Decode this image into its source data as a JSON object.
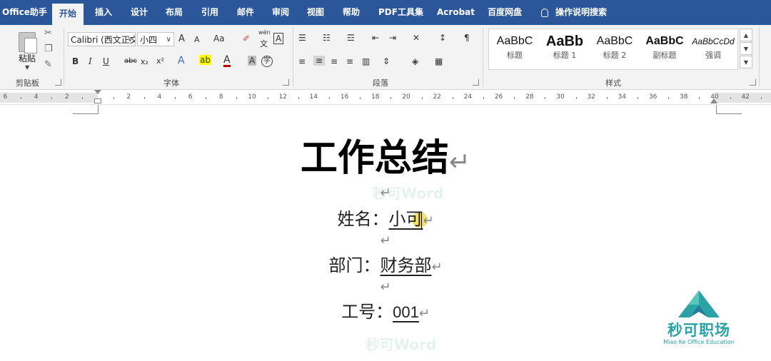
{
  "tabs": [
    {
      "label": "Office助手"
    },
    {
      "label": "开始"
    },
    {
      "label": "插入"
    },
    {
      "label": "设计"
    },
    {
      "label": "布局"
    },
    {
      "label": "引用"
    },
    {
      "label": "邮件"
    },
    {
      "label": "审阅"
    },
    {
      "label": "视图"
    },
    {
      "label": "帮助"
    },
    {
      "label": "PDF工具集"
    },
    {
      "label": "Acrobat"
    },
    {
      "label": "百度网盘"
    }
  ],
  "active_tab": "开始",
  "tell_me": "操作说明搜索",
  "ribbon": {
    "clipboard": {
      "paste_label": "粘贴",
      "group_label": "剪贴板"
    },
    "font": {
      "font_name": "Calibri (西文正文)",
      "font_size": "小四",
      "group_label": "字体",
      "grow": "A",
      "shrink": "A",
      "case": "Aa",
      "pinyin_top": "wén",
      "pinyin_bottom": "文",
      "border_char": "A",
      "bold": "B",
      "italic": "I",
      "underline": "U",
      "strike": "abc",
      "subscript": "x₂",
      "superscript": "x²",
      "effects": "A",
      "highlight": "ab",
      "font_color": "A",
      "shading": "A",
      "enclose": "字"
    },
    "paragraph": {
      "group_label": "段落"
    },
    "styles": {
      "group_label": "样式",
      "items": [
        {
          "sample": "AaBbC",
          "name": "标题"
        },
        {
          "sample": "AaBb",
          "name": "标题 1"
        },
        {
          "sample": "AaBbC",
          "name": "标题 2"
        },
        {
          "sample": "AaBbC",
          "name": "副标题"
        },
        {
          "sample": "AaBbCcDd",
          "name": "强调"
        }
      ]
    }
  },
  "ruler": {
    "numbers": [
      "6",
      "4",
      "2",
      "2",
      "4",
      "6",
      "8",
      "10",
      "12",
      "14",
      "16",
      "18",
      "20",
      "22",
      "24",
      "26",
      "28",
      "30",
      "32",
      "34",
      "36",
      "38",
      "40",
      "42"
    ]
  },
  "document": {
    "title": "工作总结",
    "paragraph_mark": "↵",
    "name_label": "姓名：",
    "name_value": "小可",
    "dept_label": "部门：",
    "dept_value": "财务部",
    "id_label": "工号：",
    "id_value": "001",
    "watermark": "秒可Word"
  },
  "brand": {
    "name": "秒可职场",
    "subtitle": "Miao Ke Office Education"
  },
  "colors": {
    "ribbon_blue": "#2b579a",
    "brand_teal": "#2aa3a7",
    "cursor_highlight": "#f2dc4c"
  }
}
